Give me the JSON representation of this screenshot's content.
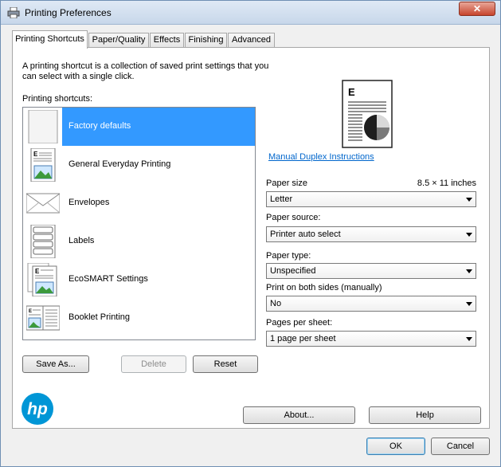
{
  "window": {
    "title": "Printing Preferences",
    "close_label": "✕"
  },
  "tabs": [
    {
      "label": "Printing Shortcuts"
    },
    {
      "label": "Paper/Quality"
    },
    {
      "label": "Effects"
    },
    {
      "label": "Finishing"
    },
    {
      "label": "Advanced"
    }
  ],
  "description": "A printing shortcut is a collection of saved print settings that you can select with a single click.",
  "shortcuts": {
    "label": "Printing shortcuts:",
    "items": [
      {
        "label": "Factory defaults",
        "icon": "blank-page-icon",
        "selected": true
      },
      {
        "label": "General Everyday Printing",
        "icon": "document-image-icon"
      },
      {
        "label": "Envelopes",
        "icon": "envelope-icon"
      },
      {
        "label": "Labels",
        "icon": "labels-sheet-icon"
      },
      {
        "label": "EcoSMART Settings",
        "icon": "eco-document-icon"
      },
      {
        "label": "Booklet Printing",
        "icon": "booklet-icon"
      }
    ]
  },
  "buttons": {
    "save_as": "Save As...",
    "delete": "Delete",
    "reset": "Reset",
    "about": "About...",
    "help": "Help",
    "ok": "OK",
    "cancel": "Cancel"
  },
  "manual_duplex_link": "Manual Duplex Instructions",
  "fields": {
    "paper_size": {
      "label": "Paper size",
      "value": "Letter",
      "size_text": "8.5 × 11 inches"
    },
    "paper_source": {
      "label": "Paper source:",
      "value": "Printer auto select"
    },
    "paper_type": {
      "label": "Paper type:",
      "value": "Unspecified"
    },
    "print_both_sides": {
      "label": "Print on both sides (manually)",
      "value": "No"
    },
    "pages_per_sheet": {
      "label": "Pages per sheet:",
      "value": "1 page per sheet"
    }
  },
  "preview": {
    "letter": "E"
  },
  "logo": {
    "text": "hp"
  },
  "colors": {
    "selection": "#3399ff",
    "link": "#0066cc",
    "hp_blue": "#0096d6"
  }
}
